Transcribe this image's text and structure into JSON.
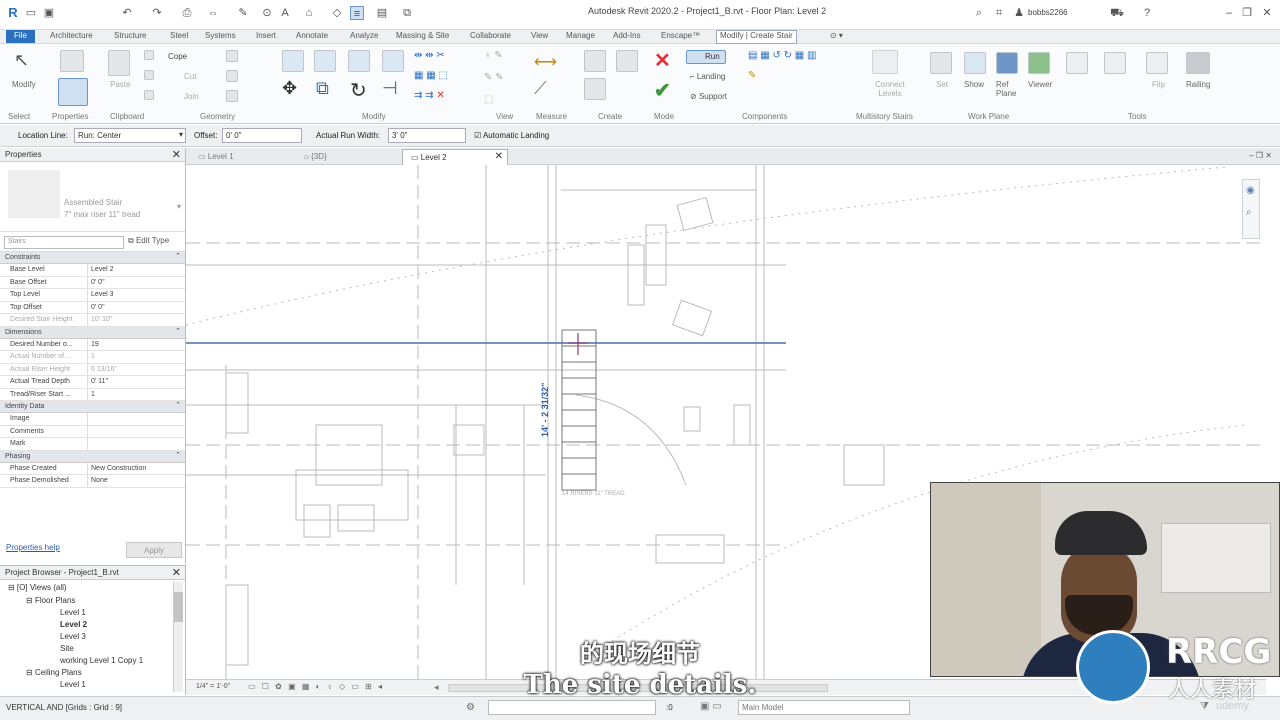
{
  "app": {
    "title": "Autodesk Revit 2020.2 - Project1_B.rvt - Floor Plan: Level 2",
    "user": "bobbs2266"
  },
  "menu_tabs": [
    "File",
    "Architecture",
    "Structure",
    "Steel",
    "Systems",
    "Insert",
    "Annotate",
    "Analyze",
    "Massing & Site",
    "Collaborate",
    "View",
    "Manage",
    "Add-Ins",
    "Enscape™",
    "Modify | Create Stair"
  ],
  "ribbon": {
    "modify": "Modify",
    "paste": "Paste",
    "cope": "Cope",
    "cut": "Cut",
    "join": "Join",
    "run": "Run",
    "landing": "Landing",
    "support": "Support",
    "connect_levels": "Connect Levels",
    "set": "Set",
    "show": "Show",
    "ref_plane": "Ref Plane",
    "viewer": "Viewer",
    "flip": "Flip",
    "railing": "Railing",
    "panels": [
      "Select",
      "Properties",
      "Clipboard",
      "Geometry",
      "Modify",
      "View",
      "Measure",
      "Create",
      "Mode",
      "Components",
      "Multistory Stairs",
      "Work Plane",
      "Tools"
    ]
  },
  "options": {
    "location_line_label": "Location Line:",
    "location_line_value": "Run: Center",
    "offset_label": "Offset:",
    "offset_value": "0' 0\"",
    "run_width_label": "Actual Run Width:",
    "run_width_value": "3' 0\"",
    "auto_landing": "Automatic Landing"
  },
  "properties": {
    "title": "Properties",
    "type_name": "Assembled Stair",
    "type_sub": "7\" max riser 11\" tread",
    "filter": "Stairs",
    "edit_type": "Edit Type",
    "sections": [
      {
        "name": "Constraints",
        "rows": [
          [
            "Base Level",
            "Level 2"
          ],
          [
            "Base Offset",
            "0' 0\""
          ],
          [
            "Top Level",
            "Level 3"
          ],
          [
            "Top Offset",
            "0' 0\""
          ],
          [
            "Desired Stair Height",
            "10' 10\""
          ]
        ]
      },
      {
        "name": "Dimensions",
        "rows": [
          [
            "Desired Number o...",
            "19"
          ],
          [
            "Actual Number of ...",
            "1"
          ],
          [
            "Actual Riser Height",
            "6 13/16\""
          ],
          [
            "Actual Tread Depth",
            "0' 11\""
          ],
          [
            "Tread/Riser Start ...",
            "1"
          ]
        ]
      },
      {
        "name": "Identity Data",
        "rows": [
          [
            "Image",
            ""
          ],
          [
            "Comments",
            ""
          ],
          [
            "Mark",
            ""
          ]
        ]
      },
      {
        "name": "Phasing",
        "rows": [
          [
            "Phase Created",
            "New Construction"
          ],
          [
            "Phase Demolished",
            "None"
          ]
        ]
      }
    ],
    "help": "Properties help",
    "apply": "Apply"
  },
  "browser": {
    "title": "Project Browser - Project1_B.rvt",
    "items": [
      "Views (all)",
      "Floor Plans",
      "Level 1",
      "Level 2",
      "Level 3",
      "Site",
      "working Level 1 Copy 1",
      "Ceiling Plans",
      "Level 1"
    ]
  },
  "view_tabs": [
    "Level 1",
    "{3D}",
    "Level 2"
  ],
  "canvas": {
    "dim_text": "14' - 2 31/32\"",
    "stair_note": "14 RISERS 11\" TREAD"
  },
  "view_control": {
    "scale": "1/4\" = 1'-0\""
  },
  "status": {
    "left": "VERTICAL AND [Grids : Grid : 9]",
    "model": "Main Model",
    "zero": ":0"
  },
  "subtitle": {
    "cn": "的现场细节",
    "en": "The site details."
  },
  "watermark": {
    "brand": "RRCG",
    "cn": "人人素材",
    "udemy": "udemy"
  }
}
